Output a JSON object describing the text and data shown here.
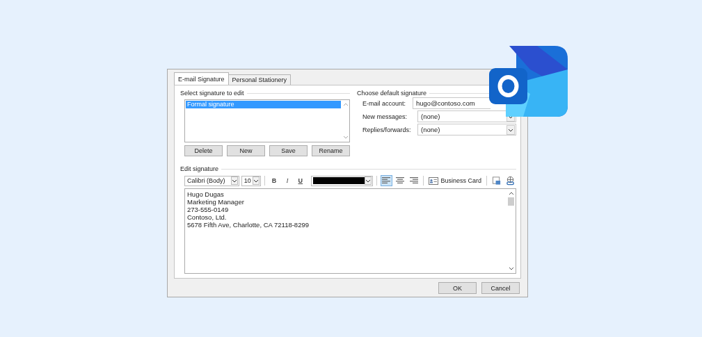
{
  "tabs": [
    {
      "label": "E-mail Signature",
      "selected": true
    },
    {
      "label": "Personal Stationery",
      "selected": false
    }
  ],
  "select_signature": {
    "title": "Select signature to edit",
    "items": [
      {
        "label": "Formal signature",
        "selected": true
      }
    ],
    "buttons": [
      "Delete",
      "New",
      "Save",
      "Rename"
    ]
  },
  "default_signature": {
    "title": "Choose default signature",
    "fields": [
      {
        "label": "E-mail account:",
        "value": "hugo@contoso.com",
        "kind": "text"
      },
      {
        "label": "New messages:",
        "value": "(none)",
        "kind": "dropdown"
      },
      {
        "label": "Replies/forwards:",
        "value": "(none)",
        "kind": "dropdown"
      }
    ]
  },
  "edit_signature": {
    "title": "Edit signature",
    "font": "Calibri (Body)",
    "size": "10",
    "styles": [
      "B",
      "I",
      "U"
    ],
    "alignments": [
      {
        "kind": "left",
        "selected": true
      },
      {
        "kind": "center",
        "selected": false
      },
      {
        "kind": "right",
        "selected": false
      }
    ],
    "business_card": "Business Card",
    "lines": [
      "Hugo Dugas",
      "Marketing Manager",
      "273-555-0149",
      "Contoso, Ltd.",
      "5678 Fifth Ave, Charlotte, CA 72118-8299"
    ]
  },
  "footer_buttons": [
    "OK",
    "Cancel"
  ]
}
